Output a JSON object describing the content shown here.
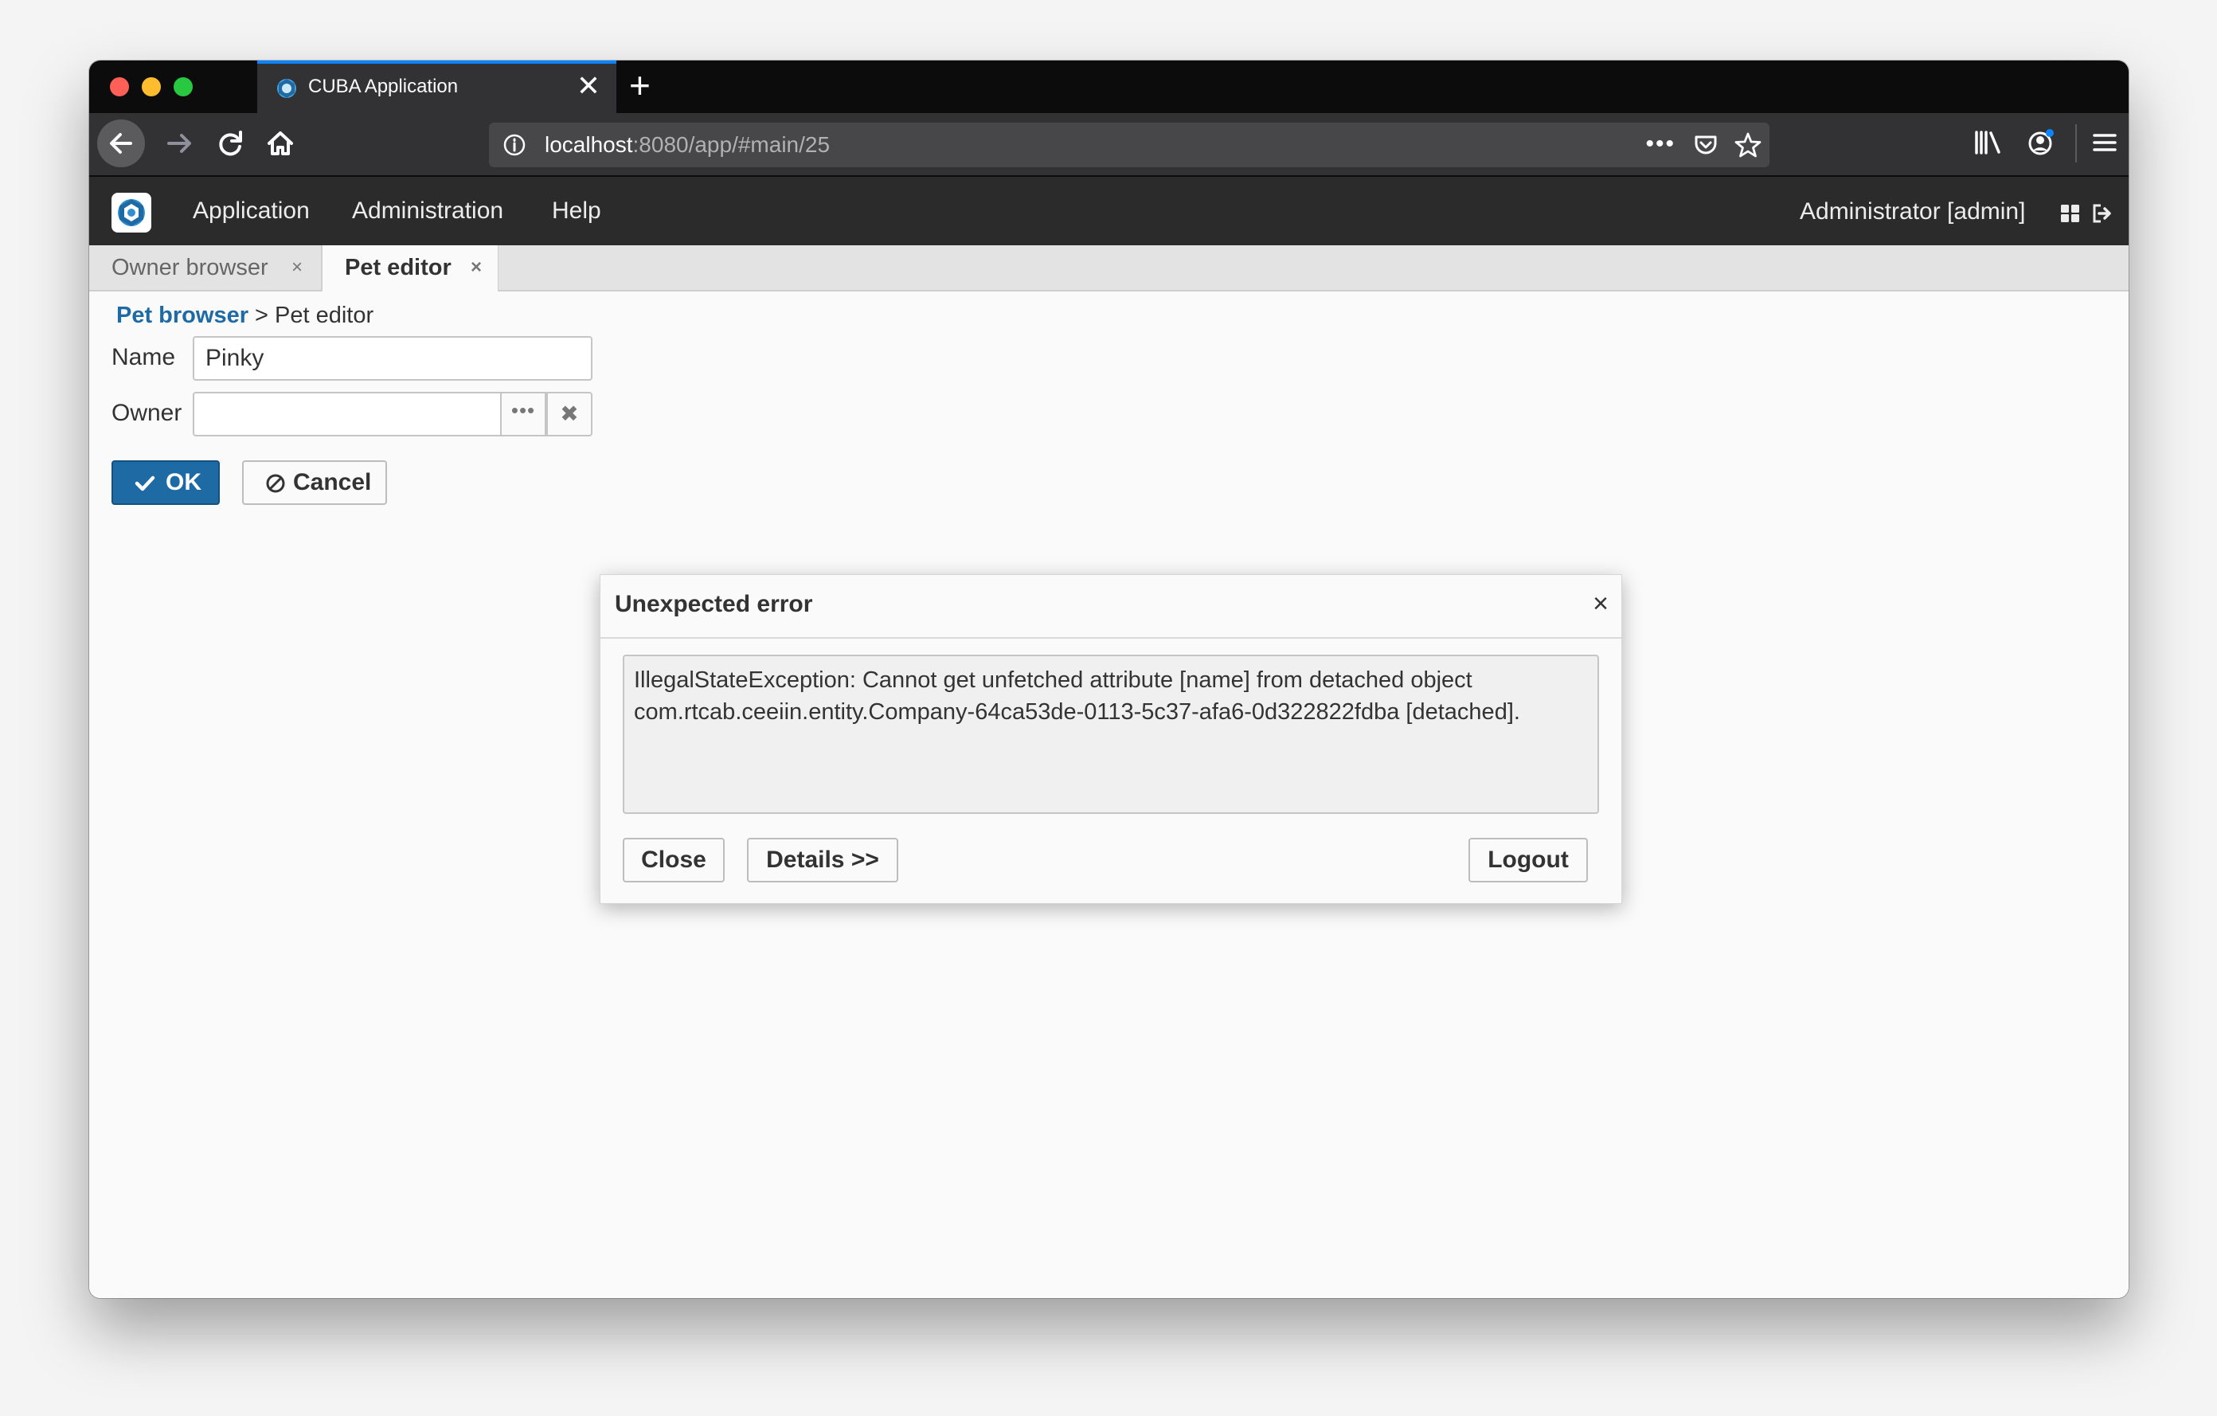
{
  "browser": {
    "tab_title": "CUBA Application",
    "tab_close": "✕",
    "new_tab": "+",
    "url_host": "localhost",
    "url_rest": ":8080/app/#main/25",
    "url_more": "•••"
  },
  "app": {
    "menu": [
      {
        "label": "Application"
      },
      {
        "label": "Administration"
      },
      {
        "label": "Help"
      }
    ],
    "user": "Administrator [admin]"
  },
  "screen_tabs": [
    {
      "label": "Owner browser",
      "close": "×"
    },
    {
      "label": "Pet editor",
      "close": "×"
    }
  ],
  "editor": {
    "breadcrumb_link": "Pet browser",
    "breadcrumb_rest": "> Pet editor",
    "name_label": "Name",
    "name_value": "Pinky",
    "owner_label": "Owner",
    "owner_value": "",
    "owner_pick": "•••",
    "owner_clear": "✖",
    "ok_label": "OK",
    "cancel_label": "Cancel"
  },
  "dialog": {
    "title": "Unexpected error",
    "close_icon": "×",
    "message": "IllegalStateException: Cannot get unfetched attribute [name] from detached object\ncom.rtcab.ceeiin.entity.Company-64ca53de-0113-5c37-afa6-0d322822fdba [detached].",
    "close_label": "Close",
    "details_label": "Details >>",
    "logout_label": "Logout"
  },
  "colors": {
    "accent": "#1d6aa5",
    "app_header": "#2b2b2b",
    "browser_chrome": "#323234",
    "browser_tab_accent": "#0a84ff"
  },
  "icons": [
    "cuba-favicon-icon",
    "close-icon",
    "plus-icon",
    "back-arrow-icon",
    "forward-arrow-icon",
    "reload-icon",
    "home-icon",
    "info-icon",
    "more-icon",
    "pocket-icon",
    "star-icon",
    "library-icon",
    "account-icon",
    "hamburger-menu-icon",
    "cuba-logo-icon",
    "grid-icon",
    "logout-icon",
    "check-icon",
    "ban-icon"
  ]
}
